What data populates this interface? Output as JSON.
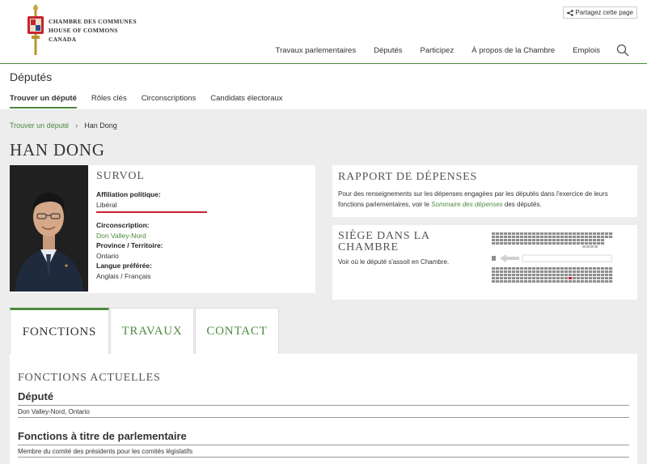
{
  "header": {
    "logo_lines": [
      "CHAMBRE DES COMMUNES",
      "HOUSE OF COMMONS",
      "CANADA"
    ],
    "share_label": "Partagez cette page",
    "nav": [
      "Travaux parlementaires",
      "Députés",
      "Participez",
      "À propos de la Chambre",
      "Emplois"
    ]
  },
  "subheader": {
    "title": "Députés",
    "tabs": [
      "Trouver un député",
      "Rôles clés",
      "Circonscriptions",
      "Candidats électoraux"
    ]
  },
  "breadcrumb": {
    "link": "Trouver un député",
    "current": "Han Dong"
  },
  "mp_name": "HAN DONG",
  "overview": {
    "title": "SURVOL",
    "affiliation_label": "Affiliation politique:",
    "affiliation_value": "Libéral",
    "riding_label": "Circonscription:",
    "riding_value": "Don Valley-Nord",
    "province_label": "Province / Territoire:",
    "province_value": "Ontario",
    "language_label": "Langue préférée:",
    "language_value": "Anglais / Français",
    "party_color": "#c8242f"
  },
  "expenses": {
    "title": "RAPPORT DE DÉPENSES",
    "text_before": "Pour des renseignements sur les dépenses engagées par les députés dans l'exercice de leurs fonctions parlementaires, voir le ",
    "link": "Sommaire des dépenses",
    "text_after": " des députés."
  },
  "seat": {
    "title": "SIÈGE DANS LA CHAMBRE",
    "text": "Voir où le député s'assoit en Chambre."
  },
  "tabs": [
    "FONCTIONS",
    "TRAVAUX",
    "CONTACT"
  ],
  "panel": {
    "section_title": "FONCTIONS ACTUELLES",
    "roles": [
      {
        "title": "Député",
        "detail": "Don Valley-Nord, Ontario"
      },
      {
        "title": "Fonctions à titre de parlementaire",
        "detail": "Membre du comité des présidents pour les comités législatifs"
      }
    ]
  },
  "colors": {
    "accent": "#4c8a3e",
    "background": "#ededed"
  }
}
